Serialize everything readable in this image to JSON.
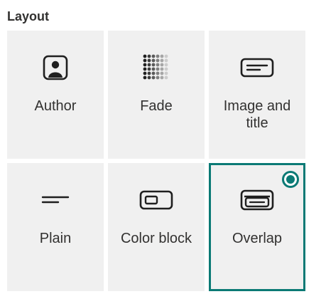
{
  "section": {
    "title": "Layout"
  },
  "accent_color": "#0b7a75",
  "tiles": [
    {
      "label": "Author",
      "icon": "author-icon",
      "selected": false
    },
    {
      "label": "Fade",
      "icon": "fade-icon",
      "selected": false
    },
    {
      "label": "Image and title",
      "icon": "image-and-title-icon",
      "selected": false
    },
    {
      "label": "Plain",
      "icon": "plain-icon",
      "selected": false
    },
    {
      "label": "Color block",
      "icon": "color-block-icon",
      "selected": false
    },
    {
      "label": "Overlap",
      "icon": "overlap-icon",
      "selected": true
    }
  ]
}
